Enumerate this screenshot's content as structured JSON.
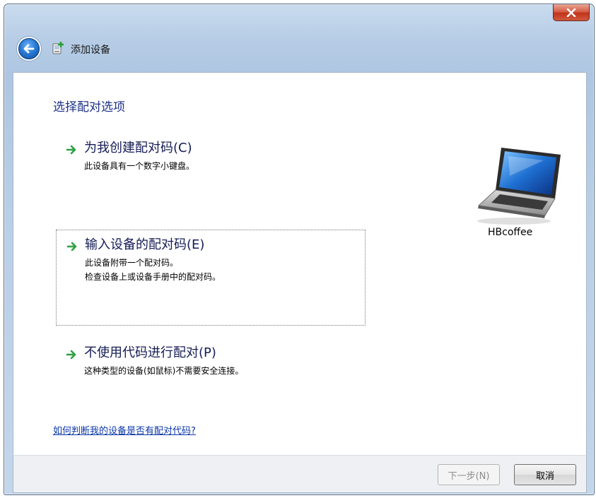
{
  "window": {
    "title": "添加设备",
    "close_icon": "close-icon"
  },
  "content": {
    "heading": "选择配对选项",
    "options": [
      {
        "title": "为我创建配对码(C)",
        "description": [
          "此设备具有一个数字小键盘。"
        ],
        "icon": "green-arrow-icon"
      },
      {
        "title": "输入设备的配对码(E)",
        "description": [
          "此设备附带一个配对码。",
          "检查设备上或设备手册中的配对码。"
        ],
        "icon": "green-arrow-icon",
        "selected": true
      },
      {
        "title": "不使用代码进行配对(P)",
        "description": [
          "这种类型的设备(如鼠标)不需要安全连接。"
        ],
        "icon": "green-arrow-icon"
      }
    ],
    "device": {
      "name": "HBcoffee",
      "icon": "laptop-icon"
    },
    "help_link": "如何判断我的设备是否有配对代码?"
  },
  "footer": {
    "next_label": "下一步(N)",
    "next_enabled": false,
    "cancel_label": "取消"
  },
  "colors": {
    "heading": "#1e3287",
    "link": "#0b36a8",
    "arrow": "#2ea043"
  }
}
